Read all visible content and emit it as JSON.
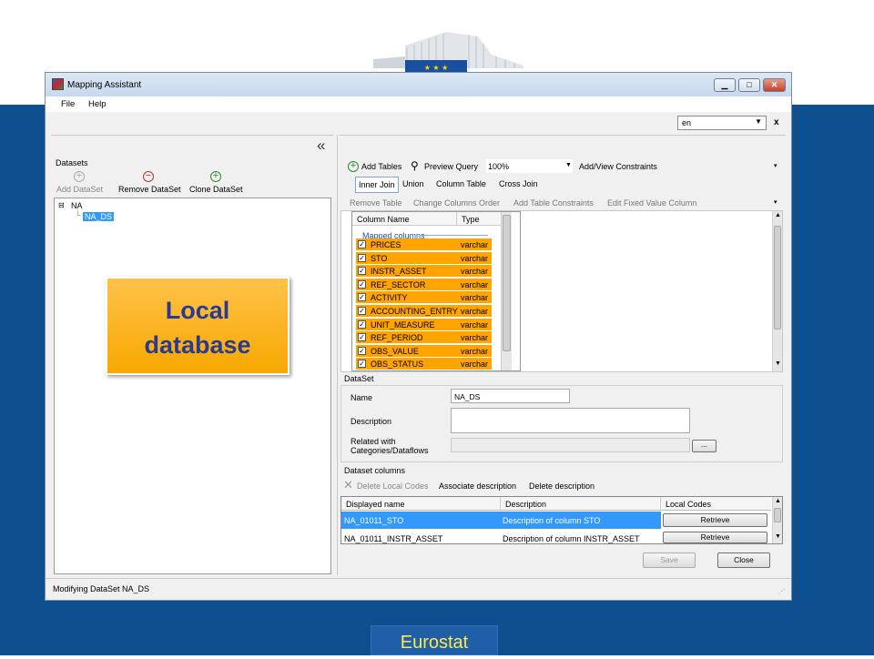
{
  "window": {
    "title": "Mapping Assistant",
    "min": "▁",
    "max": "□",
    "close": "✕"
  },
  "menu": [
    "File",
    "Help"
  ],
  "language": {
    "value": "en",
    "close": "x"
  },
  "left": {
    "collapse_glyph": "«",
    "section": "Datasets",
    "add_dataset": "Add DataSet",
    "remove_dataset": "Remove DataSet",
    "clone_dataset": "Clone DataSet",
    "tree_root": "NA",
    "tree_child": "NA_DS"
  },
  "callout": {
    "line1": "Local",
    "line2": "database"
  },
  "toolbar1": {
    "add_tables": "Add Tables",
    "preview_query": "Preview Query",
    "zoom": "100%",
    "constraints": "Add/View Constraints"
  },
  "joins": [
    "Inner Join",
    "Union",
    "Column Table",
    "Cross Join"
  ],
  "toolbar3": [
    "Remove Table",
    "Change Columns Order",
    "Add Table Constraints",
    "Edit Fixed Value Column"
  ],
  "table": {
    "headers": [
      "Column Name",
      "Type"
    ],
    "group": "Mapped columns",
    "rows": [
      {
        "name": "PRICES",
        "type": "varchar"
      },
      {
        "name": "STO",
        "type": "varchar"
      },
      {
        "name": "INSTR_ASSET",
        "type": "varchar"
      },
      {
        "name": "REF_SECTOR",
        "type": "varchar"
      },
      {
        "name": "ACTIVITY",
        "type": "varchar"
      },
      {
        "name": "ACCOUNTING_ENTRY",
        "type": "varchar"
      },
      {
        "name": "UNIT_MEASURE",
        "type": "varchar"
      },
      {
        "name": "REF_PERIOD",
        "type": "varchar"
      },
      {
        "name": "OBS_VALUE",
        "type": "varchar"
      },
      {
        "name": "OBS_STATUS",
        "type": "varchar"
      }
    ]
  },
  "dataset": {
    "section": "DataSet",
    "name_label": "Name",
    "name_value": "NA_DS",
    "description_label": "Description",
    "related_label_1": "Related with",
    "related_label_2": "Categories/Dataflows",
    "browse": "..."
  },
  "columns": {
    "section": "Dataset columns",
    "delete_codes": "Delete Local Codes",
    "associate": "Associate description",
    "delete_desc": "Delete description",
    "headers": [
      "Displayed name",
      "Description",
      "Local Codes"
    ],
    "rows": [
      {
        "name": "NA_01011_STO",
        "desc": "Description of column STO",
        "action": "Retrieve"
      },
      {
        "name": "NA_01011_INSTR_ASSET",
        "desc": "Description of column INSTR_ASSET",
        "action": "Retrieve"
      }
    ]
  },
  "buttons": {
    "save": "Save",
    "close": "Close"
  },
  "status": "Modifying DataSet NA_DS",
  "footer": "Eurostat",
  "colors": {
    "slide_blue": "#0e4f8f",
    "mapped_row": "#ffa400",
    "selection": "#3399ff",
    "callout": "#ffb81c"
  }
}
